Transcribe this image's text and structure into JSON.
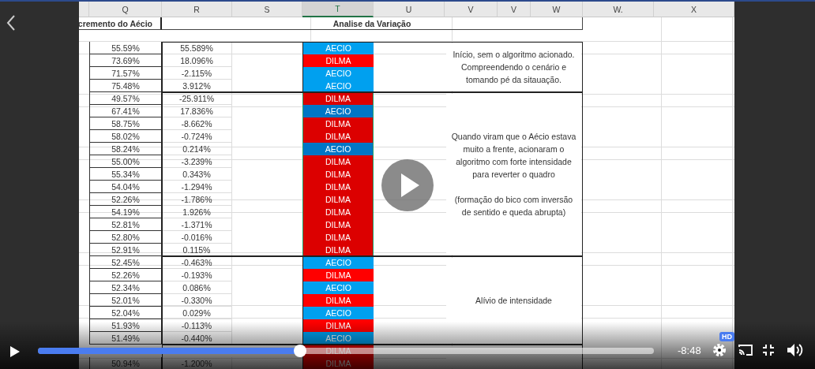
{
  "sheet": {
    "columns": [
      {
        "label": "Q",
        "selected": false
      },
      {
        "label": "R",
        "selected": false
      },
      {
        "label": "S",
        "selected": false
      },
      {
        "label": "T",
        "selected": true
      },
      {
        "label": "U",
        "selected": false
      },
      {
        "label": "V",
        "selected": false
      },
      {
        "label": "V",
        "selected": false
      },
      {
        "label": "W",
        "selected": false
      },
      {
        "label": "W.",
        "selected": false
      },
      {
        "label": "X",
        "selected": false
      }
    ],
    "left_title": "cremento do Aécio",
    "right_title": "Analise da Variação",
    "groups": [
      {
        "selected": false,
        "note": "Início, sem o algoritmo acionado. Compreendendo o cenário e tomando pé da sitauação.",
        "rows": [
          {
            "q": "55.59%",
            "r": "55.589%",
            "t": {
              "kind": "aecio",
              "label": "AECIO"
            }
          },
          {
            "q": "73.69%",
            "r": "18.096%",
            "t": {
              "kind": "dilma",
              "label": "DILMA"
            }
          },
          {
            "q": "71.57%",
            "r": "-2.115%",
            "t": {
              "kind": "aecio",
              "label": "AECIO"
            }
          },
          {
            "q": "75.48%",
            "r": "3.912%",
            "t": {
              "kind": "aecio",
              "label": "AECIO"
            }
          }
        ]
      },
      {
        "selected": true,
        "note": "Quando viram que o Aécio estava muito a frente, acionaram o algoritmo com forte intensidade para reverter o quadro\n\n(formação do bico com inversão de sentido e queda abrupta)",
        "rows": [
          {
            "q": "49.57%",
            "r": "-25.911%",
            "t": {
              "kind": "dilma",
              "label": "DILMA"
            }
          },
          {
            "q": "67.41%",
            "r": "17.836%",
            "t": {
              "kind": "aecio",
              "label": "AECIO"
            }
          },
          {
            "q": "58.75%",
            "r": "-8.662%",
            "t": {
              "kind": "dilma",
              "label": "DILMA"
            }
          },
          {
            "q": "58.02%",
            "r": "-0.724%",
            "t": {
              "kind": "dilma",
              "label": "DILMA"
            }
          },
          {
            "q": "58.24%",
            "r": "0.214%",
            "t": {
              "kind": "aecio",
              "label": "AECIO"
            }
          },
          {
            "q": "55.00%",
            "r": "-3.239%",
            "t": {
              "kind": "dilma",
              "label": "DILMA"
            }
          },
          {
            "q": "55.34%",
            "r": "0.343%",
            "t": {
              "kind": "dilma",
              "label": "DILMA"
            }
          },
          {
            "q": "54.04%",
            "r": "-1.294%",
            "t": {
              "kind": "dilma",
              "label": "DILMA"
            }
          },
          {
            "q": "52.26%",
            "r": "-1.786%",
            "t": {
              "kind": "dilma",
              "label": "DILMA"
            }
          },
          {
            "q": "54.19%",
            "r": "1.926%",
            "t": {
              "kind": "dilma",
              "label": "DILMA"
            }
          },
          {
            "q": "52.81%",
            "r": "-1.371%",
            "t": {
              "kind": "dilma",
              "label": "DILMA"
            }
          },
          {
            "q": "52.80%",
            "r": "-0.016%",
            "t": {
              "kind": "dilma",
              "label": "DILMA"
            }
          },
          {
            "q": "52.91%",
            "r": "0.115%",
            "t": {
              "kind": "dilma",
              "label": "DILMA"
            }
          }
        ]
      },
      {
        "selected": false,
        "note": "Alívio de intensidade",
        "rows": [
          {
            "q": "52.45%",
            "r": "-0.463%",
            "t": {
              "kind": "aecio",
              "label": "AECIO"
            }
          },
          {
            "q": "52.26%",
            "r": "-0.193%",
            "t": {
              "kind": "dilma",
              "label": "DILMA"
            }
          },
          {
            "q": "52.34%",
            "r": "0.086%",
            "t": {
              "kind": "aecio",
              "label": "AECIO"
            }
          },
          {
            "q": "52.01%",
            "r": "-0.330%",
            "t": {
              "kind": "dilma",
              "label": "DILMA"
            }
          },
          {
            "q": "52.04%",
            "r": "0.029%",
            "t": {
              "kind": "aecio",
              "label": "AECIO"
            }
          },
          {
            "q": "51.93%",
            "r": "-0.113%",
            "t": {
              "kind": "dilma",
              "label": "DILMA"
            }
          },
          {
            "q": "51.49%",
            "r": "-0.440%",
            "t": {
              "kind": "aecio",
              "label": "AECIO"
            }
          }
        ]
      },
      {
        "selected": false,
        "rows": [
          {
            "t": {
              "kind": "dilma",
              "label": "DILMA"
            }
          },
          {
            "q": "50.94%",
            "r": "-1.200%",
            "t": {
              "kind": "dilma",
              "label": "DILMA"
            }
          }
        ]
      }
    ]
  },
  "player": {
    "time": "-8:48",
    "level": 0.426,
    "hd_badge": "HD"
  }
}
